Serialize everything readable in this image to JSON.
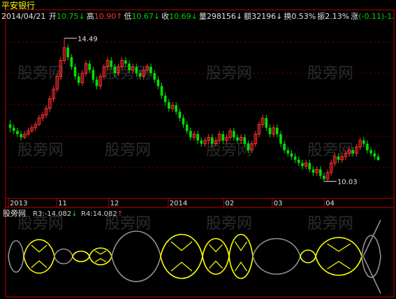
{
  "stock_name": "平安银行",
  "info_bar": {
    "date": "2014/04/21",
    "items": [
      {
        "label": "开",
        "value": "10.75",
        "arrow": "↓",
        "color": "#00d000"
      },
      {
        "label": "高",
        "value": "10.90",
        "arrow": "↑",
        "color": "#ff3030"
      },
      {
        "label": "低",
        "value": "10.67",
        "arrow": "↓",
        "color": "#00d000"
      },
      {
        "label": "收",
        "value": "10.69",
        "arrow": "↓",
        "color": "#00d000"
      },
      {
        "label": "量",
        "value": "298156",
        "arrow": "↓",
        "color": "#e0e0e0"
      },
      {
        "label": "额",
        "value": "32196",
        "arrow": "↓",
        "color": "#e0e0e0"
      },
      {
        "label": "换",
        "value": "0.53%",
        "arrow": "",
        "color": "#e0e0e0"
      },
      {
        "label": "振",
        "value": "2.13%",
        "arrow": "",
        "color": "#e0e0e0"
      },
      {
        "label": "涨",
        "value": "(-0.11)-1.",
        "arrow": "",
        "color": "#00d000"
      }
    ]
  },
  "watermark": "股旁网",
  "colors": {
    "up": "#ff3030",
    "down": "#00e000",
    "axis": "#c00000",
    "grid": "#7a0000",
    "indicator_main": "#ffff00",
    "indicator_alt": "#909090"
  },
  "chart_data": {
    "type": "candlestick",
    "price_range": [
      9.8,
      14.9
    ],
    "annotations": [
      {
        "text": "14.49",
        "value": 14.49
      },
      {
        "text": "10.03",
        "value": 10.03
      }
    ],
    "x_tick_labels": [
      "2013",
      "11",
      "12",
      "2014",
      "02",
      "03",
      "04"
    ],
    "candles": [
      [
        11.8,
        11.7,
        11.95,
        11.55
      ],
      [
        11.7,
        11.6,
        11.8,
        11.5
      ],
      [
        11.6,
        11.5,
        11.7,
        11.4
      ],
      [
        11.5,
        11.4,
        11.6,
        11.3
      ],
      [
        11.4,
        11.5,
        11.6,
        11.35
      ],
      [
        11.5,
        11.6,
        11.7,
        11.45
      ],
      [
        11.6,
        11.7,
        11.8,
        11.55
      ],
      [
        11.7,
        11.8,
        11.9,
        11.6
      ],
      [
        11.8,
        12.0,
        12.1,
        11.75
      ],
      [
        12.0,
        12.1,
        12.2,
        11.9
      ],
      [
        12.1,
        12.3,
        12.4,
        12.0
      ],
      [
        12.3,
        12.6,
        12.7,
        12.2
      ],
      [
        12.6,
        12.9,
        13.0,
        12.5
      ],
      [
        12.9,
        13.3,
        13.4,
        12.8
      ],
      [
        13.3,
        13.8,
        13.9,
        13.2
      ],
      [
        13.8,
        14.2,
        14.49,
        13.7
      ],
      [
        14.2,
        13.9,
        14.3,
        13.8
      ],
      [
        13.9,
        13.6,
        14.0,
        13.5
      ],
      [
        13.6,
        13.3,
        13.7,
        13.2
      ],
      [
        13.3,
        13.1,
        13.4,
        13.0
      ],
      [
        13.1,
        13.4,
        13.5,
        13.0
      ],
      [
        13.4,
        13.7,
        13.8,
        13.3
      ],
      [
        13.7,
        13.5,
        13.8,
        13.4
      ],
      [
        13.5,
        13.2,
        13.6,
        13.1
      ],
      [
        13.2,
        13.0,
        13.3,
        12.9
      ],
      [
        13.0,
        13.3,
        13.4,
        12.9
      ],
      [
        13.3,
        13.6,
        13.7,
        13.2
      ],
      [
        13.6,
        13.8,
        13.9,
        13.5
      ],
      [
        13.8,
        13.6,
        13.9,
        13.5
      ],
      [
        13.6,
        13.4,
        13.7,
        13.3
      ],
      [
        13.4,
        13.6,
        13.7,
        13.3
      ],
      [
        13.6,
        13.8,
        13.9,
        13.5
      ],
      [
        13.8,
        13.7,
        13.9,
        13.6
      ],
      [
        13.7,
        13.5,
        13.8,
        13.4
      ],
      [
        13.5,
        13.6,
        13.7,
        13.4
      ],
      [
        13.6,
        13.4,
        13.7,
        13.3
      ],
      [
        13.4,
        13.3,
        13.5,
        13.2
      ],
      [
        13.3,
        13.5,
        13.6,
        13.2
      ],
      [
        13.5,
        13.6,
        13.7,
        13.4
      ],
      [
        13.6,
        13.4,
        13.7,
        13.3
      ],
      [
        13.4,
        13.2,
        13.5,
        13.1
      ],
      [
        13.2,
        13.0,
        13.3,
        12.9
      ],
      [
        13.0,
        12.7,
        13.1,
        12.6
      ],
      [
        12.7,
        12.5,
        12.8,
        12.4
      ],
      [
        12.5,
        12.3,
        12.6,
        12.2
      ],
      [
        12.3,
        12.4,
        12.5,
        12.2
      ],
      [
        12.4,
        12.2,
        12.5,
        12.1
      ],
      [
        12.2,
        12.0,
        12.3,
        11.9
      ],
      [
        12.0,
        11.8,
        12.1,
        11.7
      ],
      [
        11.8,
        11.6,
        11.9,
        11.5
      ],
      [
        11.6,
        11.4,
        11.7,
        11.3
      ],
      [
        11.4,
        11.5,
        11.6,
        11.3
      ],
      [
        11.5,
        11.3,
        11.6,
        11.2
      ],
      [
        11.3,
        11.2,
        11.4,
        11.1
      ],
      [
        11.2,
        11.3,
        11.4,
        11.1
      ],
      [
        11.3,
        11.4,
        11.5,
        11.2
      ],
      [
        11.4,
        11.2,
        11.5,
        11.1
      ],
      [
        11.2,
        11.3,
        11.4,
        11.1
      ],
      [
        11.3,
        11.5,
        11.6,
        11.2
      ],
      [
        11.5,
        11.3,
        11.6,
        11.2
      ],
      [
        11.3,
        11.4,
        11.5,
        11.2
      ],
      [
        11.4,
        11.6,
        11.7,
        11.3
      ],
      [
        11.6,
        11.4,
        11.7,
        11.3
      ],
      [
        11.4,
        11.3,
        11.5,
        11.2
      ],
      [
        11.3,
        11.4,
        11.5,
        11.2
      ],
      [
        11.4,
        11.2,
        11.5,
        11.1
      ],
      [
        11.2,
        11.0,
        11.3,
        10.9
      ],
      [
        11.0,
        11.2,
        11.3,
        10.9
      ],
      [
        11.2,
        11.5,
        11.6,
        11.1
      ],
      [
        11.5,
        11.8,
        11.9,
        11.4
      ],
      [
        11.8,
        12.0,
        12.1,
        11.7
      ],
      [
        12.0,
        11.7,
        12.1,
        11.6
      ],
      [
        11.7,
        11.5,
        11.8,
        11.4
      ],
      [
        11.5,
        11.7,
        11.8,
        11.4
      ],
      [
        11.7,
        11.5,
        11.8,
        11.4
      ],
      [
        11.5,
        11.2,
        11.6,
        11.1
      ],
      [
        11.2,
        11.0,
        11.3,
        10.9
      ],
      [
        11.0,
        10.9,
        11.1,
        10.8
      ],
      [
        10.9,
        10.8,
        11.0,
        10.7
      ],
      [
        10.8,
        10.7,
        10.9,
        10.6
      ],
      [
        10.7,
        10.6,
        10.8,
        10.5
      ],
      [
        10.6,
        10.5,
        10.7,
        10.4
      ],
      [
        10.5,
        10.6,
        10.7,
        10.4
      ],
      [
        10.6,
        10.4,
        10.7,
        10.3
      ],
      [
        10.4,
        10.3,
        10.5,
        10.2
      ],
      [
        10.3,
        10.4,
        10.5,
        10.2
      ],
      [
        10.4,
        10.2,
        10.5,
        10.1
      ],
      [
        10.2,
        10.1,
        10.3,
        10.03
      ],
      [
        10.1,
        10.3,
        10.4,
        10.05
      ],
      [
        10.3,
        10.6,
        10.7,
        10.2
      ],
      [
        10.6,
        10.8,
        10.9,
        10.5
      ],
      [
        10.8,
        10.7,
        10.9,
        10.6
      ],
      [
        10.7,
        10.8,
        10.9,
        10.6
      ],
      [
        10.8,
        10.9,
        11.0,
        10.7
      ],
      [
        10.9,
        11.0,
        11.1,
        10.8
      ],
      [
        11.0,
        10.9,
        11.1,
        10.8
      ],
      [
        10.9,
        11.1,
        11.2,
        10.8
      ],
      [
        11.1,
        11.3,
        11.4,
        11.0
      ],
      [
        11.3,
        11.2,
        11.4,
        11.1
      ],
      [
        11.2,
        11.0,
        11.3,
        10.9
      ],
      [
        11.0,
        10.9,
        11.1,
        10.8
      ],
      [
        10.9,
        10.8,
        11.0,
        10.7
      ],
      [
        10.8,
        10.69,
        10.9,
        10.67
      ]
    ]
  },
  "indicator": {
    "name": "股旁网",
    "r3_label": "R3:",
    "r3_value": "-14.082",
    "r3_arrow": "↓",
    "r4_label": "R4:",
    "r4_value": "14.082",
    "r4_arrow": "↑"
  }
}
